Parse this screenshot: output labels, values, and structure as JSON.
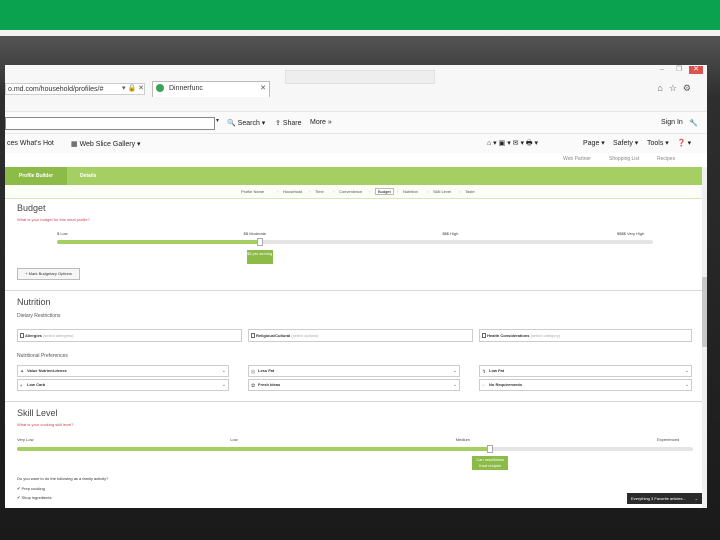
{
  "browser": {
    "url": "o.md.com/household/profiles/#",
    "tab_title": "Dinnerfunc",
    "search_label": "Search",
    "share_label": "Share",
    "more_label": "More »",
    "signin_label": "Sign In",
    "favorites": [
      "ces What's Hot",
      "Web Slice Gallery"
    ],
    "commands": [
      "Page",
      "Safety",
      "Tools"
    ],
    "util_links": [
      "Web Partner",
      "Shopping List",
      "Recipes"
    ]
  },
  "app": {
    "tabs": [
      "Profile Builder",
      "Details"
    ],
    "steps": [
      "Profile Name",
      "Household",
      "Time",
      "Convenience",
      "Budget",
      "Nutrition",
      "Skill Level",
      "Taste"
    ],
    "active_step": 4
  },
  "budget": {
    "title": "Budget",
    "subtitle": "What is your budget for this meal profile?",
    "ticks": [
      "$ Low",
      "$$ Moderate",
      "$$$ High",
      "$$$$ Very High"
    ],
    "level_fraction": 0.34,
    "callout": "$5 per serving",
    "category_button": "+ Mark Budgetary Options"
  },
  "nutrition": {
    "title": "Nutrition",
    "restrictions_label": "Dietary Restrictions",
    "restrictions": [
      {
        "label": "Allergies",
        "hint": "(select allergens)"
      },
      {
        "label": "Religious/Cultural",
        "hint": "(select options)"
      },
      {
        "label": "Health Considerations",
        "hint": "(select category)"
      }
    ],
    "preferences_label": "Nutritional Preferences",
    "preferences": [
      "Value Nutrient-dense",
      "Less Fat",
      "Low Fat",
      "Low Carb",
      "Fresh Ideas",
      "No Requirements"
    ]
  },
  "skill": {
    "title": "Skill Level",
    "subtitle": "What is your cooking skill level?",
    "ticks": [
      "Very Low",
      "Low",
      "Medium",
      "Experienced"
    ],
    "level_fraction": 0.7,
    "callout": "Can read/follow food recipes",
    "question": "Do you want to do the following as a family activity?",
    "checks": [
      "Prep cooking",
      "Shop ingredients"
    ]
  },
  "toast": "Everything 3 Favorite articles..."
}
